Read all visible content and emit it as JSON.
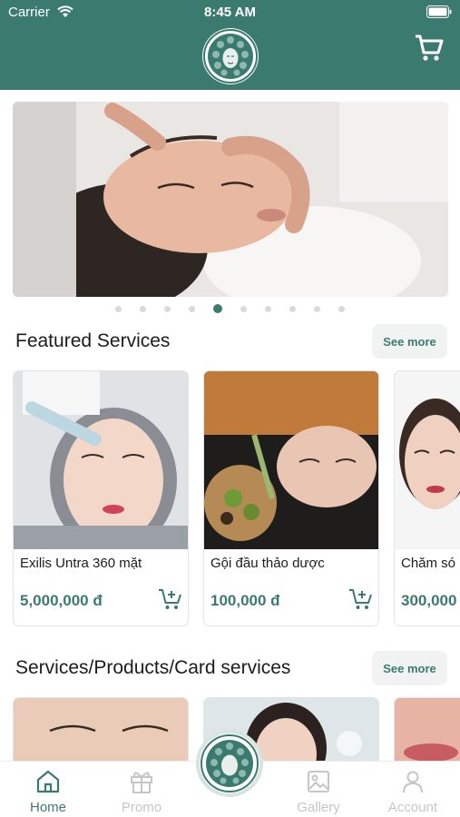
{
  "status_bar": {
    "carrier": "Carrier",
    "time": "8:45 AM"
  },
  "brand": {
    "primary": "#3b7b6f",
    "accent_text": "#3b7b6f"
  },
  "banner": {
    "page_count": 10,
    "active_index": 4
  },
  "featured": {
    "title": "Featured Services",
    "see_more": "See more",
    "items": [
      {
        "name": "Exilis Untra 360 mặt",
        "price": "5,000,000 đ"
      },
      {
        "name": "Gội đầu thảo dược",
        "price": "100,000 đ"
      },
      {
        "name": "Chăm só",
        "price": "300,000"
      }
    ]
  },
  "services": {
    "title": "Services/Products/Card services",
    "see_more": "See more"
  },
  "nav": {
    "items": [
      {
        "label": "Home",
        "icon": "home-icon",
        "active": true
      },
      {
        "label": "Promo",
        "icon": "gift-icon",
        "active": false
      },
      {
        "label": "Gallery",
        "icon": "image-icon",
        "active": false
      },
      {
        "label": "Account",
        "icon": "user-icon",
        "active": false
      }
    ]
  }
}
